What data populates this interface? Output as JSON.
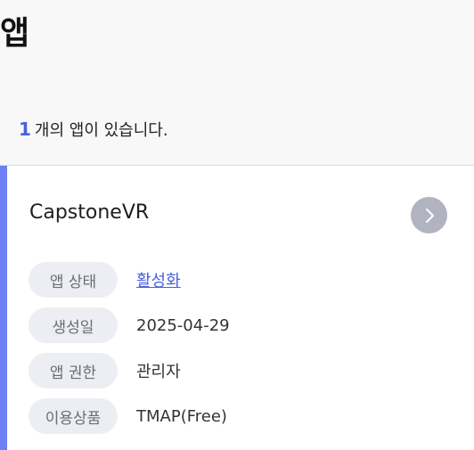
{
  "page": {
    "title": "앱",
    "count_value": "1",
    "count_suffix": "개의 앱이 있습니다."
  },
  "app_card": {
    "name": "CapstoneVR",
    "details": [
      {
        "label": "앱 상태",
        "value": "활성화"
      },
      {
        "label": "생성일",
        "value": "2025-04-29"
      },
      {
        "label": "앱 권한",
        "value": "관리자"
      },
      {
        "label": "이용상품",
        "value": "TMAP(Free)"
      }
    ]
  },
  "icons": {
    "open_app": "chevron-right-icon"
  },
  "colors": {
    "accent": "#6f7ff5",
    "link": "#4a5fe0",
    "button_bg": "#b1b3c1",
    "label_bg": "#edeef3"
  }
}
